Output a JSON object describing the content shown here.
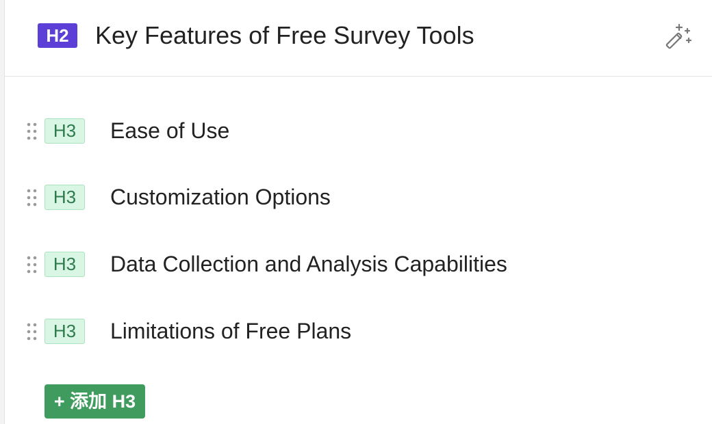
{
  "section": {
    "heading_tag": "H2",
    "title": "Key Features of Free Survey Tools",
    "magic_icon": "magic-wand-icon"
  },
  "subheadings": [
    {
      "tag": "H3",
      "title": "Ease of Use"
    },
    {
      "tag": "H3",
      "title": "Customization Options"
    },
    {
      "tag": "H3",
      "title": "Data Collection and Analysis Capabilities"
    },
    {
      "tag": "H3",
      "title": "Limitations of Free Plans"
    }
  ],
  "add_button": {
    "label": "+ 添加 H3"
  },
  "colors": {
    "h2_badge": "#5b3fd6",
    "h3_badge_bg": "#d9f6e4",
    "h3_badge_text": "#2f7a4c",
    "add_button": "#3f9b5e"
  }
}
